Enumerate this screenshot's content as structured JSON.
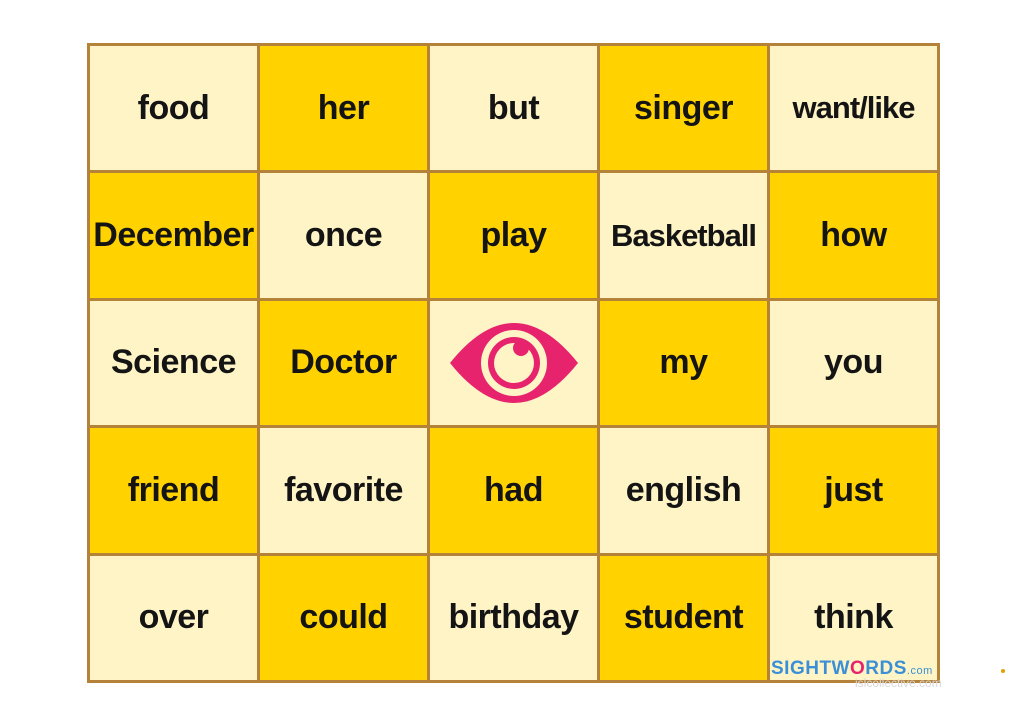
{
  "grid": {
    "rows": [
      [
        {
          "word": "food",
          "shade": "light"
        },
        {
          "word": "her",
          "shade": "dark"
        },
        {
          "word": "but",
          "shade": "light"
        },
        {
          "word": "singer",
          "shade": "dark"
        },
        {
          "word": "want/like",
          "shade": "light"
        }
      ],
      [
        {
          "word": "December",
          "shade": "dark"
        },
        {
          "word": "once",
          "shade": "light"
        },
        {
          "word": "play",
          "shade": "dark"
        },
        {
          "word": "Basketball",
          "shade": "light"
        },
        {
          "word": "how",
          "shade": "dark"
        }
      ],
      [
        {
          "word": "Science",
          "shade": "light"
        },
        {
          "word": "Doctor",
          "shade": "dark"
        },
        {
          "word": "",
          "shade": "light",
          "icon": "eye-icon"
        },
        {
          "word": "my",
          "shade": "dark"
        },
        {
          "word": "you",
          "shade": "light"
        }
      ],
      [
        {
          "word": "friend",
          "shade": "dark"
        },
        {
          "word": "favorite",
          "shade": "light"
        },
        {
          "word": "had",
          "shade": "dark"
        },
        {
          "word": "english",
          "shade": "light"
        },
        {
          "word": "just",
          "shade": "dark"
        }
      ],
      [
        {
          "word": "over",
          "shade": "light"
        },
        {
          "word": "could",
          "shade": "dark"
        },
        {
          "word": "birthday",
          "shade": "light"
        },
        {
          "word": "student",
          "shade": "dark"
        },
        {
          "word": "think",
          "shade": "light"
        }
      ]
    ]
  },
  "colors": {
    "light_cell": "#fef4c6",
    "dark_cell": "#ffd200",
    "border": "#b5823a",
    "eye": "#e8236e"
  },
  "watermark": {
    "brand_prefix": "SIGHTW",
    "brand_o": "O",
    "brand_suffix": "RDS",
    "domain": ".com",
    "secondary": "islcollective.com"
  }
}
